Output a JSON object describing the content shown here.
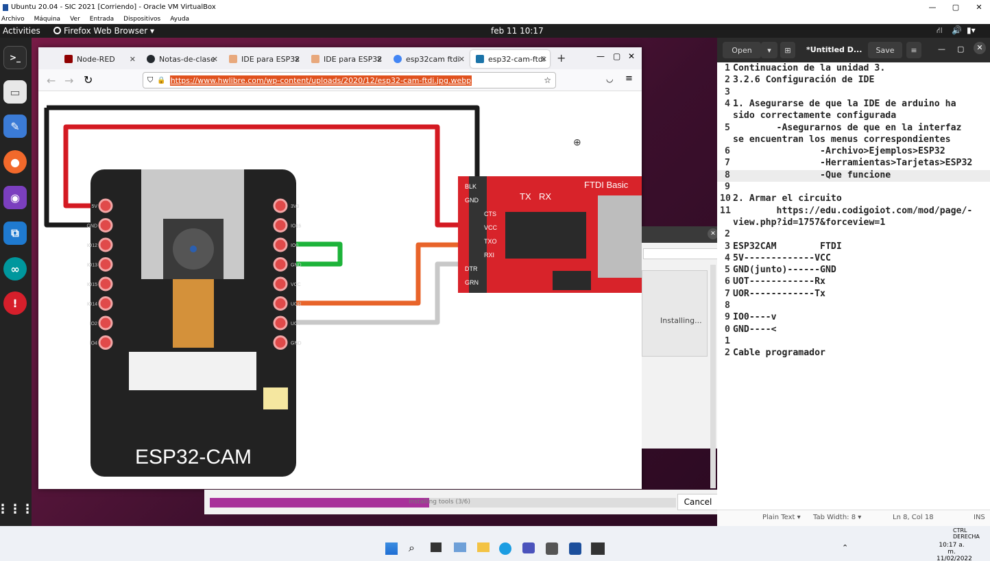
{
  "vbox": {
    "title": "Ubuntu 20.04 - SIC 2021 [Corriendo] - Oracle VM VirtualBox",
    "menu": [
      "Archivo",
      "Máquina",
      "Ver",
      "Entrada",
      "Dispositivos",
      "Ayuda"
    ]
  },
  "topbar": {
    "activities": "Activities",
    "app": "Firefox Web Browser ▾",
    "clock": "feb 11  10:17"
  },
  "browser": {
    "tabs": [
      {
        "label": "Node-RED",
        "color": "#8f0000"
      },
      {
        "label": "Notas-de-clase",
        "color": "#24292e"
      },
      {
        "label": "IDE para ESP32",
        "color": "#e8a87c"
      },
      {
        "label": "IDE para ESP32",
        "color": "#e8a87c"
      },
      {
        "label": "esp32cam ftdi",
        "color": "#4285f4"
      },
      {
        "label": "esp32-cam-ftdi",
        "color": "#1a73a8"
      }
    ],
    "new_tab": "+",
    "url": "https://www.hwlibre.com/wp-content/uploads/2020/12/esp32-cam-ftdi.jpg.webp",
    "image": {
      "board_label": "ESP32-CAM",
      "ftdi_label": "FTDI Basic",
      "ftdi_leds": [
        "TX",
        "RX"
      ],
      "ftdi_pins": [
        "BLK",
        "GND",
        "CTS",
        "VCC",
        "TXO",
        "RXI",
        "DTR",
        "GRN"
      ],
      "left_pins": [
        "5V",
        "GND",
        "IO12",
        "IO13",
        "IO15",
        "IO14",
        "IO2",
        "IO4"
      ],
      "right_pins": [
        "3V3",
        "IO16",
        "IO0",
        "GND",
        "VCC",
        "UOR",
        "UOT",
        "GND"
      ]
    }
  },
  "gedit": {
    "open": "Open",
    "title": "*Untitled D...",
    "save": "Save",
    "lines": [
      {
        "n": "1",
        "t": "Continuacion de la unidad 3."
      },
      {
        "n": "2",
        "t": "3.2.6 Configuración de IDE"
      },
      {
        "n": "3",
        "t": ""
      },
      {
        "n": "4",
        "t": "1. Asegurarse de que la IDE de arduino ha"
      },
      {
        "n": "",
        "t": "sido correctamente configurada"
      },
      {
        "n": "5",
        "t": "        -Asegurarnos de que en la interfaz"
      },
      {
        "n": "",
        "t": "se encuentran los menus correspondientes"
      },
      {
        "n": "6",
        "t": "                -Archivo>Ejemplos>ESP32"
      },
      {
        "n": "7",
        "t": "                -Herramientas>Tarjetas>ESP32"
      },
      {
        "n": "8",
        "t": "                -Que funcione"
      },
      {
        "n": "9",
        "t": ""
      },
      {
        "n": "10",
        "t": "2. Armar el circuito"
      },
      {
        "n": "11",
        "t": "        https://edu.codigoiot.com/mod/page/-"
      },
      {
        "n": "",
        "t": "view.php?id=1757&forceview=1"
      },
      {
        "n": "2",
        "t": ""
      },
      {
        "n": "3",
        "t": "ESP32CAM        FTDI"
      },
      {
        "n": "4",
        "t": "5V-------------VCC"
      },
      {
        "n": "5",
        "t": "GND(junto)------GND"
      },
      {
        "n": "6",
        "t": "UOT------------Rx"
      },
      {
        "n": "7",
        "t": "UOR------------Tx"
      },
      {
        "n": "8",
        "t": ""
      },
      {
        "n": "9",
        "t": "IO0----v"
      },
      {
        "n": "0",
        "t": "GND----<"
      },
      {
        "n": "1",
        "t": ""
      },
      {
        "n": "2",
        "t": "Cable programador"
      }
    ],
    "status": {
      "lang": "Plain Text ▾",
      "tab": "Tab Width: 8 ▾",
      "pos": "Ln 8, Col 18",
      "ins": "INS"
    }
  },
  "dialog": {
    "status": "Installing...",
    "progress_text": "Installing tools (3/6)",
    "progress": 0.47,
    "cancel": "Cancel"
  },
  "taskbar": {
    "time": "10:17 a. m.",
    "date": "11/02/2022",
    "tray_label": "CTRL DERECHA"
  }
}
